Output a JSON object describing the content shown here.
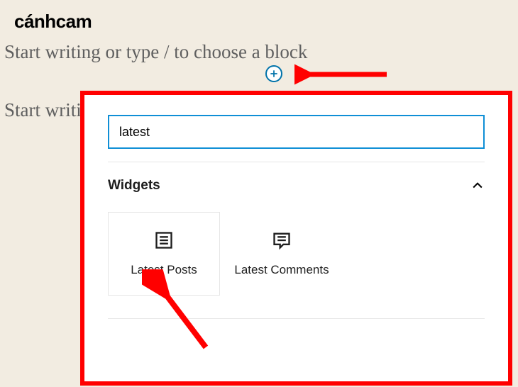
{
  "watermark": "cánhcam",
  "editor": {
    "placeholder1": "Start writing or type / to choose a block",
    "placeholder2": "Start writi"
  },
  "search": {
    "value": "latest"
  },
  "panel": {
    "section_title": "Widgets",
    "items": [
      {
        "label": "Latest Posts"
      },
      {
        "label": "Latest Comments"
      }
    ]
  }
}
